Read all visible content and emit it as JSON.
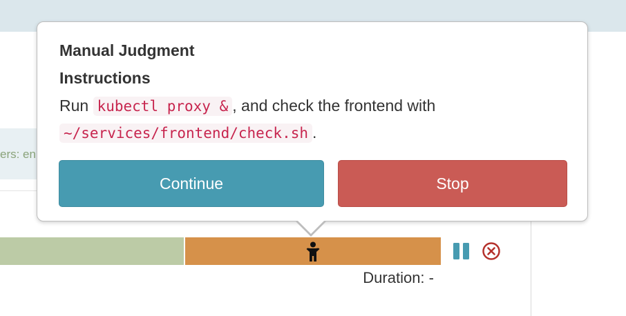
{
  "background": {
    "info_strip_text": "ers: en"
  },
  "pipeline": {
    "duration_label": "Duration: -",
    "stage_colors": {
      "completed": "#bccba6",
      "manual_judgment": "#d6914a"
    },
    "icons": {
      "stage_icon": "person-icon",
      "pause": "pause-icon",
      "cancel": "cancel-icon"
    }
  },
  "popover": {
    "title": "Manual Judgment",
    "subtitle": "Instructions",
    "instructions": {
      "prefix": "Run ",
      "command1": "kubectl proxy &",
      "middle": ", and check the frontend with ",
      "command2": "~/services/frontend/check.sh",
      "suffix": "."
    },
    "buttons": {
      "continue_label": "Continue",
      "stop_label": "Stop"
    },
    "colors": {
      "continue": "#479bb1",
      "stop": "#ca5b55",
      "code_text": "#c7254e"
    }
  }
}
